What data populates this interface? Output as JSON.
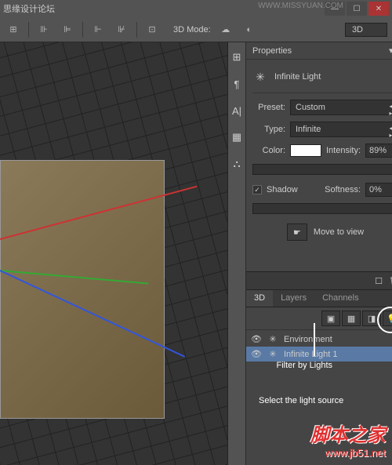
{
  "topbar": {
    "title_cn": "思缘设计论坛",
    "url": "WWW.MISSYUAN.COM"
  },
  "toolbar": {
    "mode_label": "3D Mode:",
    "dropdown": "3D"
  },
  "properties": {
    "panel_title": "Properties",
    "light_title": "Infinite Light",
    "preset_label": "Preset:",
    "preset_value": "Custom",
    "type_label": "Type:",
    "type_value": "Infinite",
    "color_label": "Color:",
    "intensity_label": "Intensity:",
    "intensity_value": "89%",
    "shadow_label": "Shadow",
    "softness_label": "Softness:",
    "softness_value": "0%",
    "move_to_view": "Move to view"
  },
  "panel3d": {
    "tabs": [
      "3D",
      "Layers",
      "Channels"
    ],
    "items": [
      {
        "name": "Environment",
        "icon": "✳"
      },
      {
        "name": "Infinite Light 1",
        "icon": "✳"
      }
    ]
  },
  "annotations": {
    "filter": "Filter by Lights",
    "select": "Select the light source"
  },
  "watermark": {
    "cn": "脚本之家",
    "url": "www.jb51.net"
  }
}
